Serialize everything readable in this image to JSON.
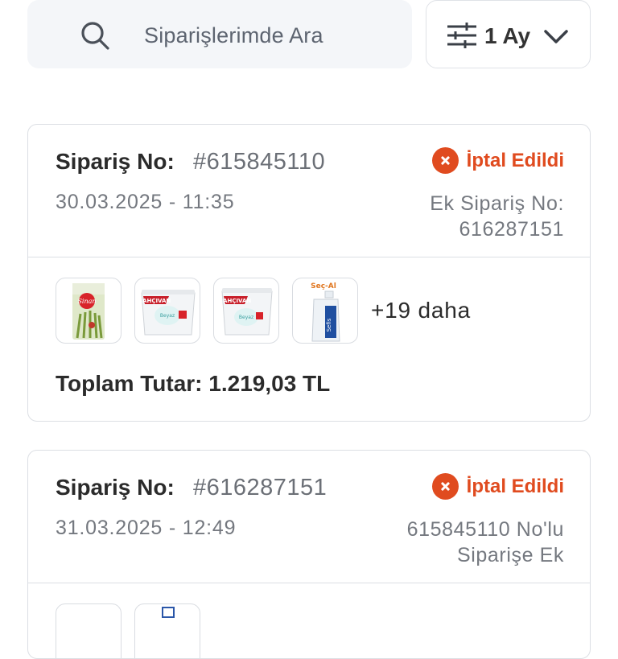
{
  "search": {
    "placeholder": "Siparişlerimde Ara"
  },
  "filter": {
    "label": "1 Ay"
  },
  "orders": [
    {
      "label": "Sipariş No:",
      "number": "#615845110",
      "date": "30.03.2025 - 11:35",
      "status": "İptal Edildi",
      "extra_line1": "Ek Sipariş No:",
      "extra_line2": "616287151",
      "products": [
        "sinan-flour-bag",
        "bahcivan-cheese-tub",
        "bahcivan-cheese-tub",
        "sec-al-bottle"
      ],
      "more": "+19 daha",
      "total": "Toplam Tutar: 1.219,03 TL"
    },
    {
      "label": "Sipariş No:",
      "number": "#616287151",
      "date": "31.03.2025 - 12:49",
      "status": "İptal Edildi",
      "extra_line1": "615845110 No'lu",
      "extra_line2": "Siparişe Ek"
    }
  ],
  "colors": {
    "accent": "#e04b1f",
    "searchBg": "#f4f6f9",
    "border": "#dcdfe4"
  }
}
